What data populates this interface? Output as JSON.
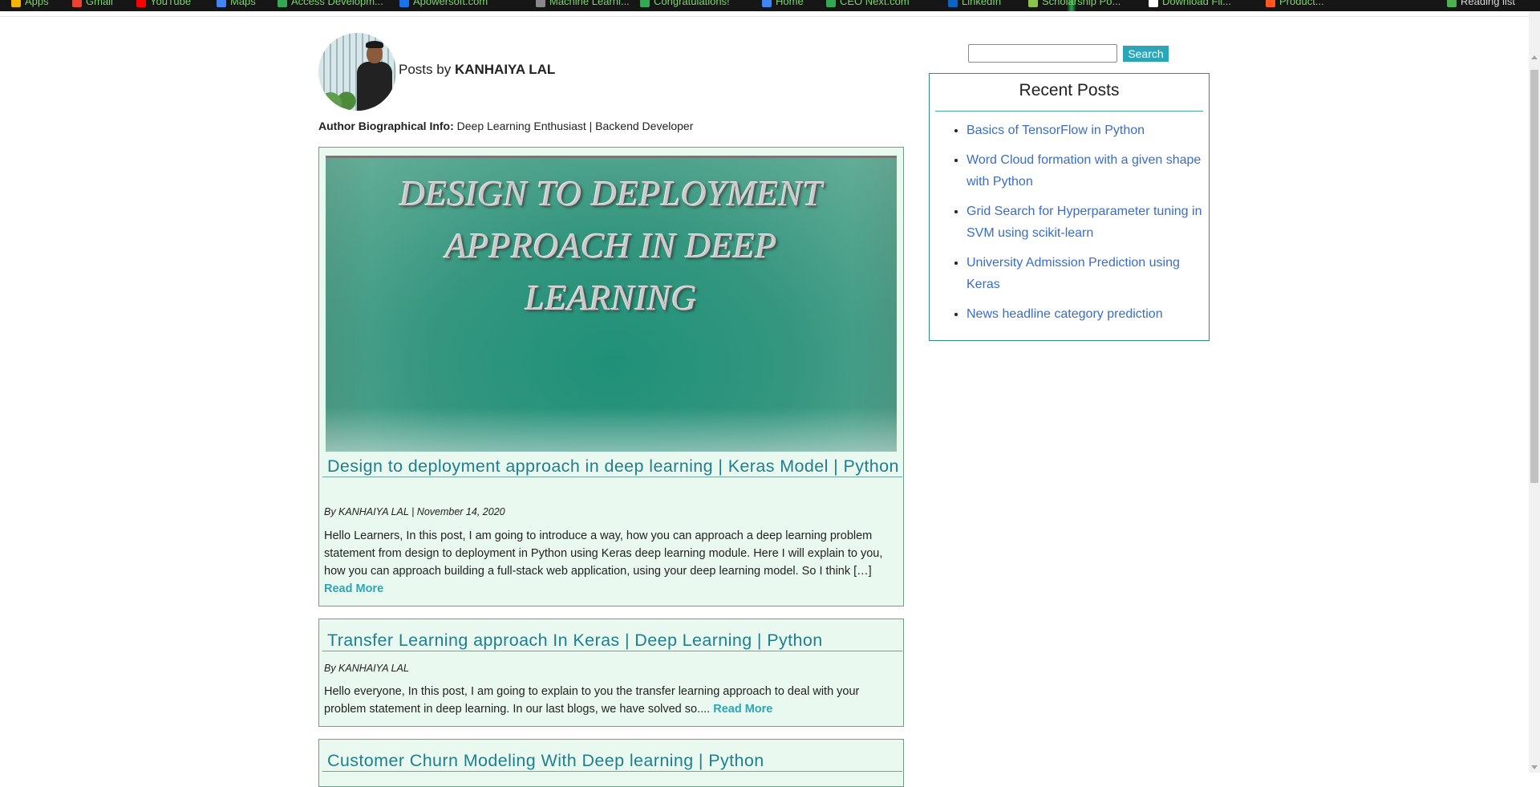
{
  "browser": {
    "bookmarks": [
      {
        "label": "Apps",
        "icon": "apps-grid-icon",
        "color": "#f4b400"
      },
      {
        "label": "Gmail",
        "icon": "gmail-icon",
        "color": "#ea4335"
      },
      {
        "label": "YouTube",
        "icon": "youtube-icon",
        "color": "#ff0000"
      },
      {
        "label": "Maps",
        "icon": "maps-icon",
        "color": "#4285f4"
      },
      {
        "label": "Access Developm...",
        "icon": "bookmark-icon",
        "color": "#34a853"
      },
      {
        "label": "Apowersoft.com",
        "icon": "bookmark-icon",
        "color": "#1a73e8"
      },
      {
        "label": "Machine Learni...",
        "icon": "bookmark-icon",
        "color": "#888888"
      },
      {
        "label": "Congratulations!",
        "icon": "bookmark-icon",
        "color": "#34a853"
      },
      {
        "label": "Home",
        "icon": "bookmark-icon",
        "color": "#4285f4"
      },
      {
        "label": "CEO Next.com",
        "icon": "bookmark-icon",
        "color": "#34a853"
      },
      {
        "label": "LinkedIn",
        "icon": "linkedin-icon",
        "color": "#0a66c2"
      },
      {
        "label": "Scholarship Po...",
        "icon": "bookmark-icon",
        "color": "#8bc34a"
      },
      {
        "label": "Download Fil...",
        "icon": "bookmark-icon",
        "color": "#ffffff"
      },
      {
        "label": "Product...",
        "icon": "bookmark-icon",
        "color": "#ff5722"
      }
    ],
    "reading_list": "Reading list"
  },
  "author": {
    "posts_by_prefix": "Posts by",
    "name": "KANHAIYA LAL",
    "bio_label": "Author Biographical Info:",
    "bio_text": "Deep Learning Enthusiast | Backend Developer"
  },
  "posts": [
    {
      "image_title_lines": [
        "DESIGN TO DEPLOYMENT",
        "APPROACH IN DEEP",
        "LEARNING"
      ],
      "title": "Design to deployment approach in deep learning | Keras Model | Python",
      "meta": "By KANHAIYA LAL | November 14, 2020",
      "excerpt": "Hello Learners, In this post, I am going to introduce a way, how you can approach a deep learning problem statement from design to deployment in Python using Keras deep learning module. Here I will explain to you, how you can approach building a full-stack web application, using your deep learning model. So I think […]",
      "read_more": "Read More"
    },
    {
      "title": "Transfer Learning approach In Keras | Deep Learning | Python",
      "meta": "By KANHAIYA LAL",
      "excerpt": "Hello everyone, In this post, I am going to explain to you the transfer learning approach to deal with your problem statement in deep learning. In our last blogs, we have solved so....",
      "read_more": "Read More"
    },
    {
      "title": "Customer Churn Modeling With Deep learning | Python"
    }
  ],
  "sidebar": {
    "search_placeholder": "",
    "search_button": "Search",
    "recent_title": "Recent Posts",
    "recent_posts": [
      "Basics of TensorFlow in Python",
      "Word Cloud formation with a given shape with Python",
      "Grid Search for Hyperparameter tuning in SVM using scikit-learn",
      "University Admission Prediction using Keras",
      "News headline category prediction"
    ]
  },
  "colors": {
    "accent": "#2aa6b8",
    "title": "#1f7f8f",
    "post_bg": "#e9f9ef",
    "link": "#3a6cc8"
  }
}
